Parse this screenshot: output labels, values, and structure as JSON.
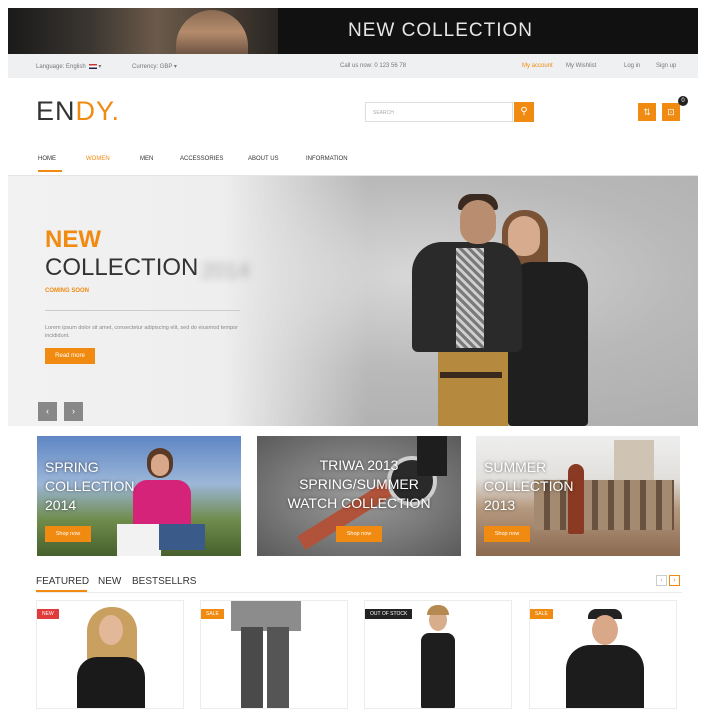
{
  "top_banner": {
    "title": "NEW COLLECTION"
  },
  "utility_bar": {
    "language": "Language: English",
    "currency": "Currency: GBP",
    "phone": "Call us now: 0 123 56 78",
    "my_account": "My account",
    "wishlist": "My Wishlist",
    "login": "Log in",
    "signup": "Sign up"
  },
  "header": {
    "logo_main": "EN",
    "logo_accent": "DY.",
    "search_placeholder": "SEARCH",
    "cart_count": "0"
  },
  "nav": {
    "items": [
      "HOME",
      "WOMEN",
      "MEN",
      "ACCESSORIES",
      "ABOUT US",
      "INFORMATION"
    ]
  },
  "hero": {
    "title_accent": "NEW",
    "title": "COLLECTION",
    "year": "2014",
    "subtitle": "COMING SOON",
    "description": "Lorem ipsum dolor sit amet, consectetur adipiscing elit, sed do eiusmod tempor incididunt.",
    "button": "Read more",
    "prev": "‹",
    "next": "›"
  },
  "promos": [
    {
      "line1": "SPRING",
      "line2": "COLLECTION",
      "line3": "2014",
      "button": "Shop now"
    },
    {
      "line1": "TRIWA 2013",
      "line2": "SPRING/SUMMER",
      "line3": "WATCH COLLECTION",
      "button": "Shop now"
    },
    {
      "line1": "SUMMER",
      "line2": "COLLECTION",
      "line3": "2013",
      "button": "Shop now"
    }
  ],
  "tabs": {
    "featured": "FEATURED",
    "new": "NEW",
    "bestsellers": "BESTSELLRS"
  },
  "products": [
    {
      "tag": "NEW"
    },
    {
      "tag": "SALE"
    },
    {
      "tag": "OUT OF STOCK"
    },
    {
      "tag": "SALE"
    }
  ],
  "colors": {
    "accent": "#f08a10",
    "banner": "#111111",
    "utility_bar": "#eef0f1"
  }
}
